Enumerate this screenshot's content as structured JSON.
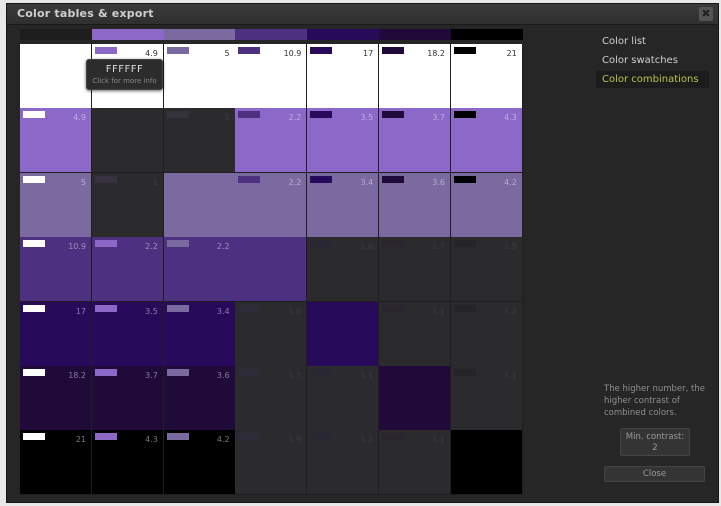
{
  "window": {
    "title": "Color tables & export",
    "close_symbol": "✖"
  },
  "colors": [
    "#FFFFFF",
    "#8c68c8",
    "#7a6aa0",
    "#4e3080",
    "#270b5a",
    "#1f0a3a",
    "#000000"
  ],
  "ratios": [
    [
      "",
      "4.9",
      "5",
      "10.9",
      "17",
      "18.2",
      "21"
    ],
    [
      "4.9",
      "",
      "1",
      "2.2",
      "3.5",
      "3.7",
      "4.3"
    ],
    [
      "5",
      "1",
      "",
      "2.2",
      "3.4",
      "3.6",
      "4.2"
    ],
    [
      "10.9",
      "2.2",
      "2.2",
      "",
      "1.6",
      "1.7",
      "1.9"
    ],
    [
      "17",
      "3.5",
      "3.4",
      "1.6",
      "",
      "1.1",
      "1.2"
    ],
    [
      "18.2",
      "3.7",
      "3.6",
      "1.7",
      "1.1",
      "",
      "1.1"
    ],
    [
      "21",
      "4.3",
      "4.2",
      "1.9",
      "1.2",
      "1.1",
      ""
    ]
  ],
  "min_contrast": 2,
  "tooltip": {
    "hex": "FFFFFF",
    "hint": "Click for more info"
  },
  "sidebar": {
    "items": [
      {
        "label": "Color list",
        "active": false
      },
      {
        "label": "Color swatches",
        "active": false
      },
      {
        "label": "Color combinations",
        "active": true
      }
    ]
  },
  "info_text": "The higher number, the higher contrast of combined colors.",
  "min_contrast_button": {
    "label": "Min. contrast:",
    "value": "2"
  },
  "close_button": {
    "label": "Close"
  }
}
